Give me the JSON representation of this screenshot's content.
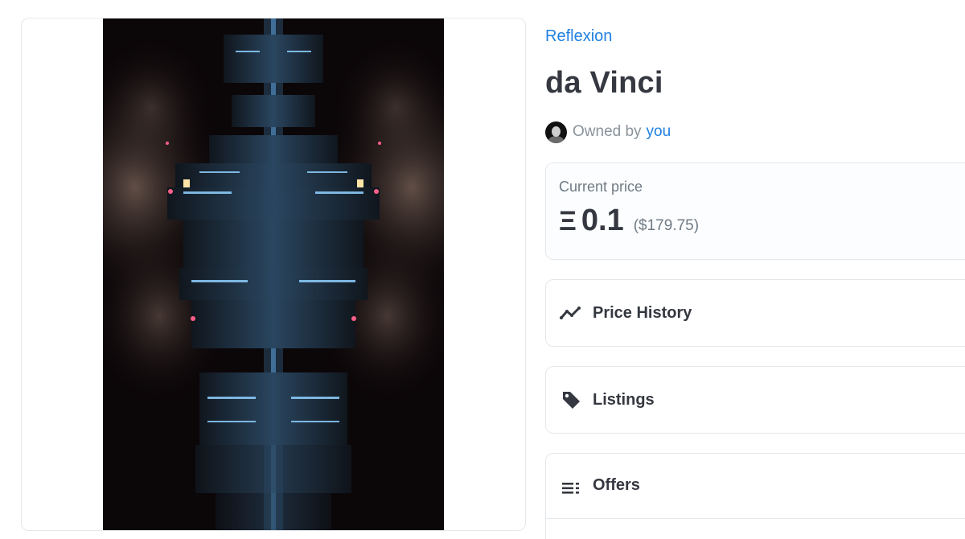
{
  "collection": {
    "name": "Reflexion"
  },
  "item": {
    "title": "da Vinci"
  },
  "owner": {
    "prefix": "Owned by",
    "name": "you"
  },
  "price": {
    "label": "Current price",
    "currency_symbol": "Ξ",
    "amount": "0.1",
    "fiat": "($179.75)"
  },
  "sections": {
    "price_history": {
      "label": "Price History",
      "icon": "trending-line-icon"
    },
    "listings": {
      "label": "Listings",
      "icon": "tag-icon"
    },
    "offers": {
      "label": "Offers",
      "icon": "list-icon"
    }
  },
  "colors": {
    "accent": "#2081e2",
    "text": "#353840",
    "muted": "#707a83",
    "border": "#e5e8eb"
  }
}
